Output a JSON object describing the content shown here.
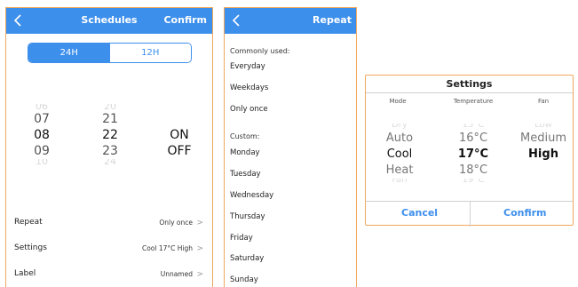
{
  "schedules": {
    "title": "Schedules",
    "confirm_label": "Confirm",
    "format_24h": "24H",
    "format_12h": "12H",
    "hours": [
      "06",
      "07",
      "08",
      "09",
      "10"
    ],
    "minutes": [
      "20",
      "21",
      "22",
      "23",
      "24"
    ],
    "state_on": "ON",
    "state_off": "OFF",
    "rows": [
      {
        "label": "Repeat",
        "value": "Only once"
      },
      {
        "label": "Settings",
        "value": "Cool 17°C High"
      },
      {
        "label": "Label",
        "value": "Unnamed"
      }
    ],
    "chevron": ">"
  },
  "repeat": {
    "title": "Repeat",
    "commonly_used_header": "Commonly used:",
    "common_items": [
      "Everyday",
      "Weekdays",
      "Only once"
    ],
    "custom_header": "Custom:",
    "custom_items": [
      "Monday",
      "Tuesday",
      "Wednesday",
      "Thursday",
      "Friday",
      "Saturday",
      "Sunday"
    ]
  },
  "settings_dialog": {
    "title": "Settings",
    "col_mode": "Mode",
    "col_temperature": "Temperature",
    "col_fan": "Fan",
    "mode_values": [
      "Dry",
      "Auto",
      "Cool",
      "Heat",
      "Fan"
    ],
    "temperature_values": [
      "15°C",
      "16°C",
      "17°C",
      "18°C",
      "19°C"
    ],
    "fan_values": [
      "Low",
      "Medium",
      "High"
    ],
    "cancel_label": "Cancel",
    "confirm_label": "Confirm"
  },
  "colors": {
    "accent": "#3d8fec",
    "border": "#f0a85e"
  },
  "icons": {
    "back": "chevron-left-icon"
  }
}
